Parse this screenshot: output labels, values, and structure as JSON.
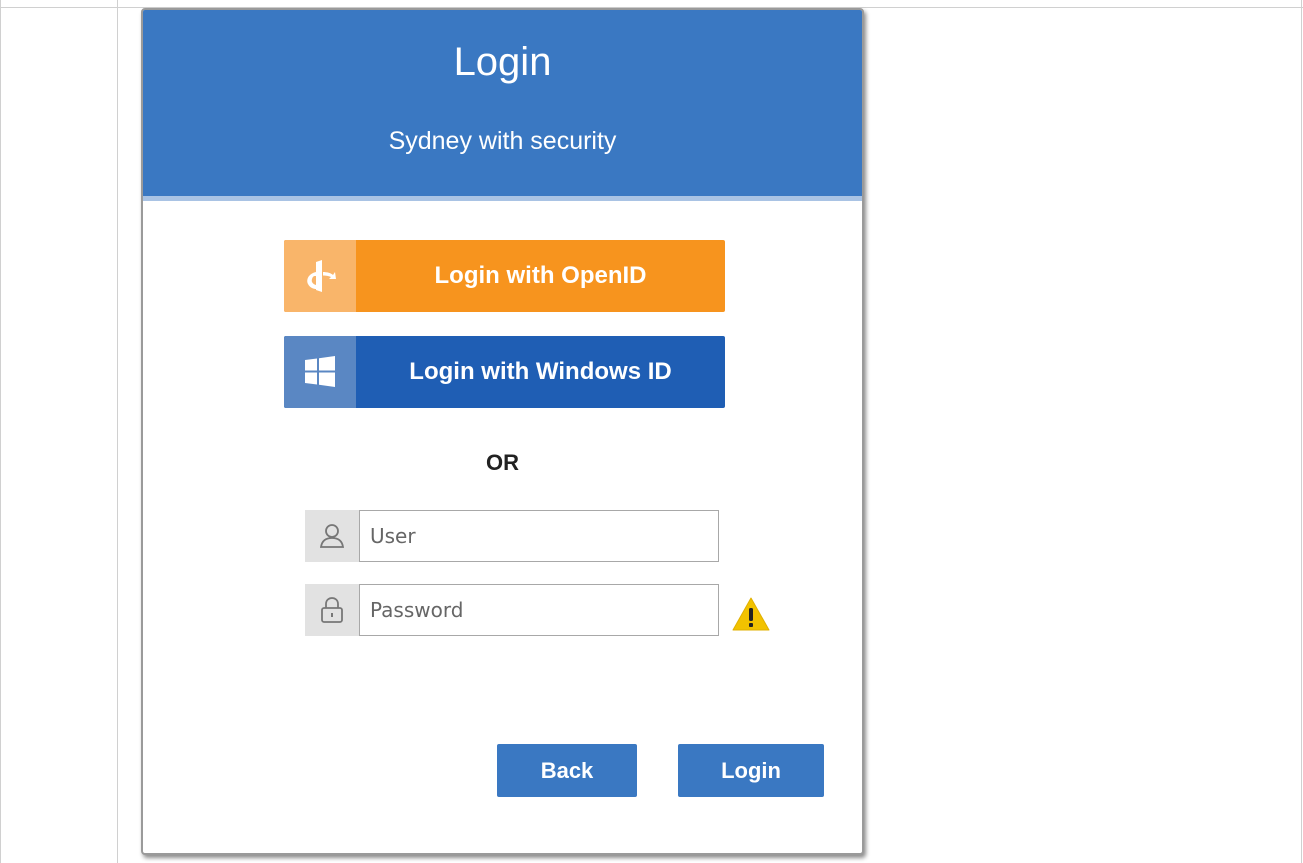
{
  "dialog": {
    "title": "Login",
    "subtitle": "Sydney with security"
  },
  "sso": {
    "openid": {
      "label": "Login with OpenID",
      "icon": "openid-icon",
      "color": "#f7941e"
    },
    "windows": {
      "label": "Login with Windows ID",
      "icon": "windows-icon",
      "color": "#1f5eb4"
    }
  },
  "separator": "OR",
  "form": {
    "user": {
      "placeholder": "User",
      "value": "",
      "icon": "user-icon"
    },
    "password": {
      "placeholder": "Password",
      "value": "",
      "icon": "lock-icon"
    },
    "warning_icon": "warning-icon"
  },
  "actions": {
    "back_label": "Back",
    "login_label": "Login"
  },
  "colors": {
    "header": "#3a78c2",
    "header_border": "#a9c3e4",
    "button": "#3a78c2",
    "warning": "#f2c200"
  }
}
